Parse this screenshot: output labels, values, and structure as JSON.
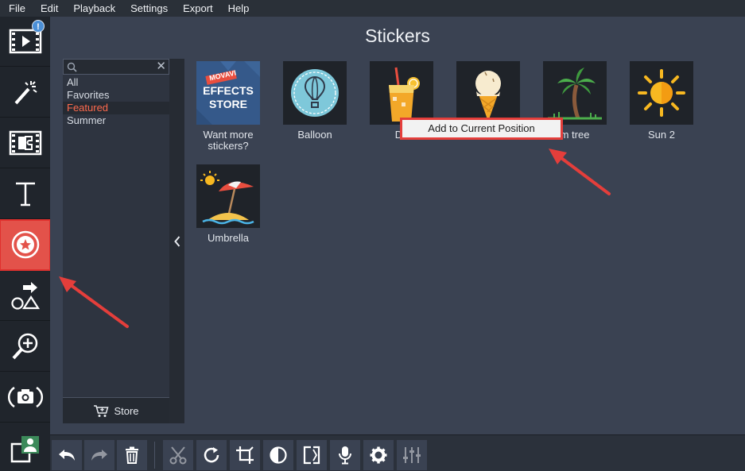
{
  "menu": [
    "File",
    "Edit",
    "Playback",
    "Settings",
    "Export",
    "Help"
  ],
  "left_tools": {
    "import_badge": "!",
    "items": [
      "import-media",
      "filters",
      "transitions",
      "titles",
      "stickers",
      "callouts",
      "zoom-pan",
      "stabilization",
      "chroma"
    ]
  },
  "panel": {
    "title": "Stickers",
    "search_placeholder": "",
    "search_clear": "✕",
    "categories": [
      {
        "label": "All",
        "selected": false
      },
      {
        "label": "Favorites",
        "selected": false
      },
      {
        "label": "Featured",
        "selected": true
      },
      {
        "label": "Summer",
        "selected": false
      }
    ],
    "store_label": "Store",
    "collapse_glyph": "‹"
  },
  "stickers": [
    {
      "label": "Want more stickers?",
      "thumb_line1": "MOVAVI",
      "thumb_line2": "EFFECTS",
      "thumb_line3": "STORE"
    },
    {
      "label": "Balloon"
    },
    {
      "label": "Dri"
    },
    {
      "label": ""
    },
    {
      "label": "m tree"
    },
    {
      "label": "Sun 2"
    },
    {
      "label": "Umbrella"
    }
  ],
  "context_menu": {
    "item": "Add to Current Position"
  },
  "bottom_tools": [
    "undo",
    "redo",
    "delete",
    "cut",
    "rotate",
    "crop",
    "color-adjust",
    "split-view",
    "record-audio",
    "settings",
    "equalizer"
  ],
  "colors": {
    "accent": "#e3524a",
    "panel_bg": "#3a4252",
    "annotation": "#e43e3b",
    "selected_category": "#ff6a4d"
  }
}
